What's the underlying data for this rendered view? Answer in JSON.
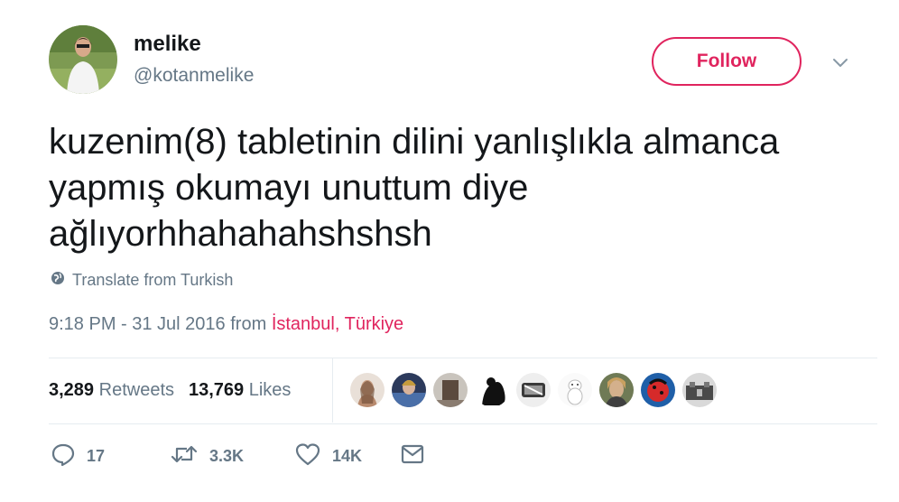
{
  "user": {
    "display_name": "melike",
    "handle": "@kotanmelike"
  },
  "header": {
    "follow_label": "Follow"
  },
  "tweet": {
    "text_lines": [
      "kuzenim(8) tabletinin dilini yanlışlıkla almanca",
      "yapmış okumayı unuttum diye",
      "ağlıyorhhahahahshshsh"
    ],
    "translate_label": "Translate from Turkish",
    "timestamp": "9:18 PM - 31 Jul 2016",
    "from_word": "from",
    "location": "İstanbul, Türkiye"
  },
  "stats": {
    "retweets_count": "3,289",
    "retweets_label": "Retweets",
    "likes_count": "13,769",
    "likes_label": "Likes"
  },
  "actions": {
    "reply_count": "17",
    "retweet_count": "3.3K",
    "like_count": "14K"
  },
  "icons": {
    "reply": "reply-icon",
    "retweet": "retweet-icon",
    "like": "heart-icon",
    "message": "envelope-icon",
    "translate": "globe-icon",
    "caret": "chevron-down-icon"
  },
  "colors": {
    "accent": "#e0245e",
    "text_primary": "#14171a",
    "text_secondary": "#657786",
    "divider": "#e6ecf0"
  }
}
